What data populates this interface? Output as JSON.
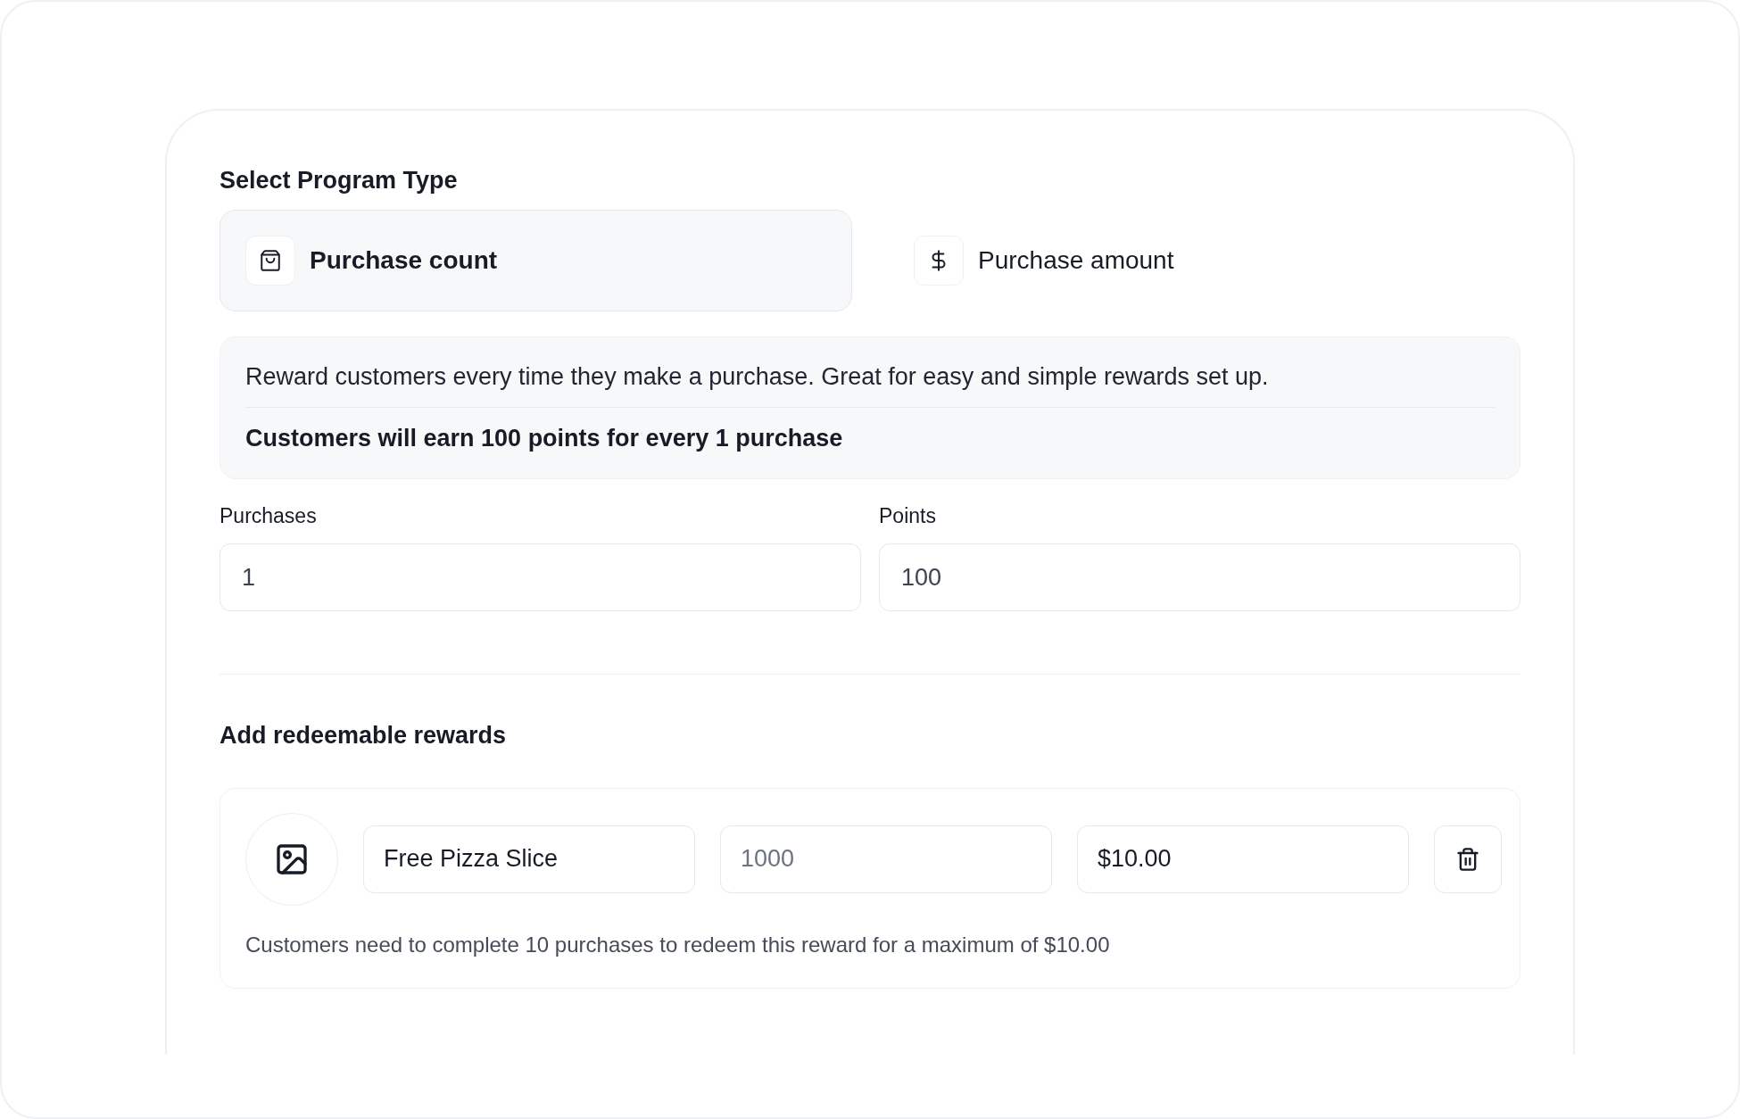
{
  "program_type": {
    "title": "Select Program Type",
    "options": [
      {
        "label": "Purchase count",
        "selected": true
      },
      {
        "label": "Purchase amount",
        "selected": false
      }
    ]
  },
  "description": {
    "text": "Reward customers every time they make a purchase. Great for easy and simple rewards set up.",
    "summary": "Customers will earn 100 points for every 1 purchase"
  },
  "fields": [
    {
      "label": "Purchases",
      "value": "1"
    },
    {
      "label": "Points",
      "value": "100"
    }
  ],
  "rewards": {
    "title": "Add redeemable rewards",
    "items": [
      {
        "name": "Free Pizza Slice",
        "points_placeholder": "1000",
        "price": "$10.00",
        "note": "Customers need to complete 10 purchases to redeem this reward for a maximum of $10.00"
      }
    ]
  }
}
